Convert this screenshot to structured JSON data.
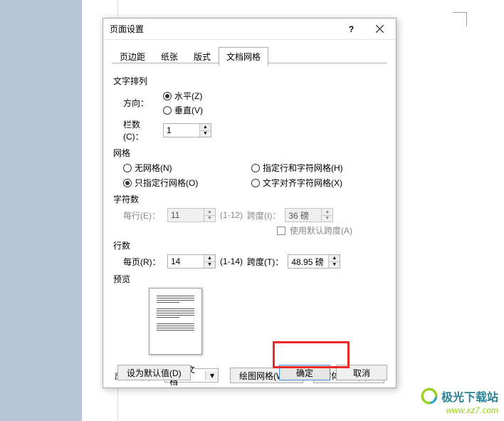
{
  "dialog": {
    "title": "页面设置",
    "help": "?",
    "tabs": {
      "margins": "页边距",
      "paper": "纸张",
      "layout": "版式",
      "grid": "文档网格"
    }
  },
  "text_arrangement": {
    "heading": "文字排列",
    "direction_label": "方向：",
    "horizontal": "水平(Z)",
    "vertical": "垂直(V)",
    "columns_label": "栏数(C)：",
    "columns_value": "1"
  },
  "grid": {
    "heading": "网格",
    "no_grid": "无网格(N)",
    "specify_line": "只指定行网格(O)",
    "specify_line_char": "指定行和字符网格(H)",
    "align_char_grid": "文字对齐字符网格(X)"
  },
  "char_count": {
    "heading": "字符数",
    "per_line_label": "每行(E)：",
    "per_line_value": "11",
    "per_line_range": "(1-12)",
    "pitch_label": "跨度(I)：",
    "pitch_value": "36 磅",
    "use_default": "使用默认跨度(A)"
  },
  "line_count": {
    "heading": "行数",
    "per_page_label": "每页(R)：",
    "per_page_value": "14",
    "per_page_range": "(1-14)",
    "pitch_label": "跨度(T)：",
    "pitch_value": "48.95 磅"
  },
  "preview": {
    "heading": "预览"
  },
  "apply": {
    "label": "应用于(Y)：",
    "value": "整篇文档",
    "draw_grid": "绘图网格(W)...",
    "font_settings": "字体设置(F)..."
  },
  "footer": {
    "set_default": "设为默认值(D)",
    "ok": "确定",
    "cancel": "取消"
  },
  "watermark": {
    "name": "极光下载站",
    "url": "www.xz7.com"
  }
}
